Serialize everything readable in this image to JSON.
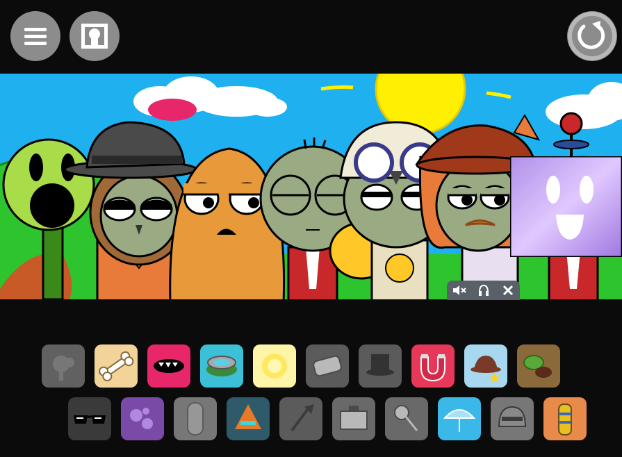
{
  "toolbar": {
    "menu_icon": "hamburger-icon",
    "avatar_icon": "avatar-frame-icon",
    "reset_icon": "reset-icon"
  },
  "colors": {
    "background": "#0b0b0b",
    "button_gray": "#8c8c8c",
    "sky": "#1fb0f0",
    "grass": "#2ec42e",
    "sun": "#ffef00"
  },
  "audio_controls": {
    "icons": [
      "mute-icon",
      "headphones-icon",
      "close-icon"
    ]
  },
  "stage": {
    "characters": [
      "peashooter",
      "brown-hair-hat-zombie",
      "orange-wallnut",
      "bald-zombie",
      "skull-helmet-zombie",
      "red-hat-mustache-zombie",
      "screen-face-zombie"
    ]
  },
  "palette_row1": [
    {
      "name": "peashooter-slot",
      "color": "#707070",
      "icon": "peashooter-icon",
      "active": false
    },
    {
      "name": "bone-slot",
      "color": "#f2d49a",
      "icon": "bone-icon",
      "active": true
    },
    {
      "name": "mouth-slot",
      "color": "#e8266a",
      "icon": "mouth-icon",
      "active": true
    },
    {
      "name": "lilypad-slot",
      "color": "#3cc0d8",
      "icon": "lilypad-icon",
      "active": true
    },
    {
      "name": "sun-slot",
      "color": "#fff5a8",
      "icon": "sun-icon",
      "active": true
    },
    {
      "name": "bandage-slot",
      "color": "#6a6a6a",
      "icon": "bandage-icon",
      "active": false
    },
    {
      "name": "top-hat-slot",
      "color": "#6a6a6a",
      "icon": "top-hat-icon",
      "active": false
    },
    {
      "name": "magnet-slot",
      "color": "#e8385a",
      "icon": "magnet-icon",
      "active": true
    },
    {
      "name": "hat-star-slot",
      "color": "#a8d8f0",
      "icon": "hat-star-icon",
      "active": true
    },
    {
      "name": "melon-slot",
      "color": "#8a6a3a",
      "icon": "melon-icon",
      "active": true
    }
  ],
  "palette_row2": [
    {
      "name": "sunglasses-slot",
      "color": "#3a3a3a",
      "icon": "sunglasses-icon",
      "active": true
    },
    {
      "name": "spores-slot",
      "color": "#7a4aa8",
      "icon": "spores-icon",
      "active": true
    },
    {
      "name": "tallnut-slot",
      "color": "#8a8a8a",
      "icon": "tallnut-icon",
      "active": false
    },
    {
      "name": "cone-slot",
      "color": "#2e5a6a",
      "icon": "cone-icon",
      "active": true
    },
    {
      "name": "shovel-slot",
      "color": "#6a6a6a",
      "icon": "shovel-icon",
      "active": false
    },
    {
      "name": "box-slot",
      "color": "#7a7a7a",
      "icon": "box-icon",
      "active": false
    },
    {
      "name": "mace-slot",
      "color": "#7a7a7a",
      "icon": "mace-icon",
      "active": false
    },
    {
      "name": "umbrella-slot",
      "color": "#3ab8e8",
      "icon": "umbrella-icon",
      "active": true
    },
    {
      "name": "helmet-slot",
      "color": "#8a8a8a",
      "icon": "helmet-icon",
      "active": false
    },
    {
      "name": "pharaoh-slot",
      "color": "#e88a4a",
      "icon": "pharaoh-icon",
      "active": true
    }
  ]
}
